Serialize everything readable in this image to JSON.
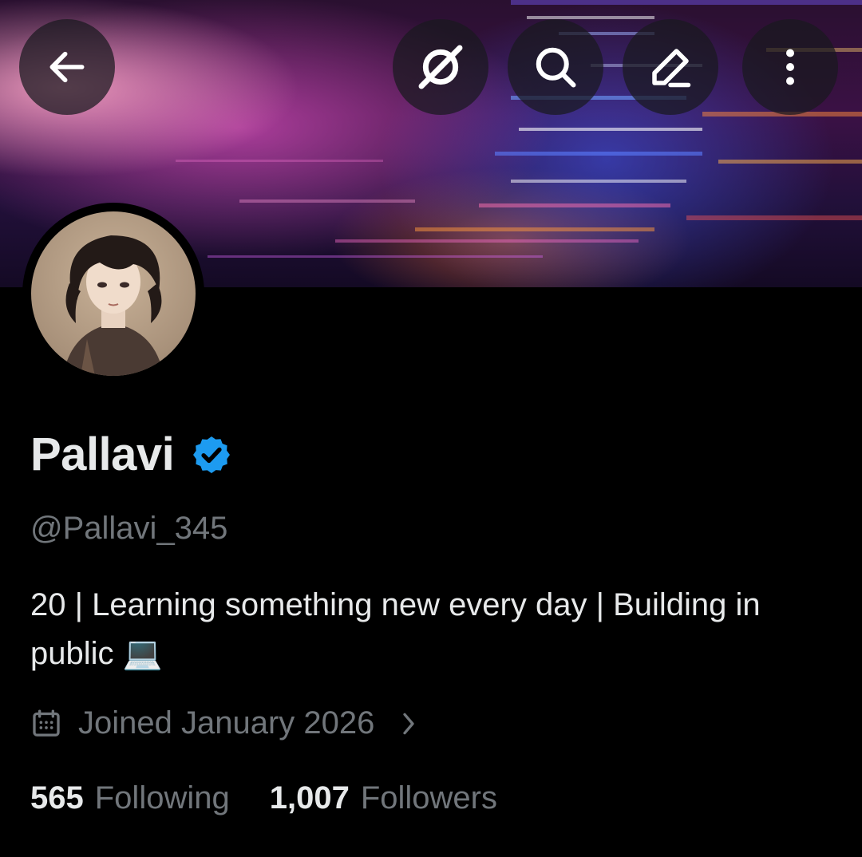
{
  "banner": {
    "image": "code-screen-banner"
  },
  "header": {
    "back_icon": "arrow-left-icon",
    "grok_icon": "slashed-circle-icon",
    "search_icon": "search-icon",
    "edit_icon": "pencil-icon",
    "more_icon": "vertical-dots-icon"
  },
  "profile": {
    "avatar": "anime-girl-avatar",
    "name": "Pallavi",
    "verified": true,
    "verified_color": "#1d9bf0",
    "handle": "@Pallavi_345",
    "bio": "20 | Learning something new every day | Building in public 💻",
    "joined": "Joined January 2026"
  },
  "stats": {
    "following_count": "565",
    "following_label": "Following",
    "followers_count": "1,007",
    "followers_label": "Followers"
  },
  "colors": {
    "background": "#000000",
    "primary_text": "#e7e9ea",
    "secondary_text": "#71767b",
    "accent": "#1d9bf0"
  }
}
